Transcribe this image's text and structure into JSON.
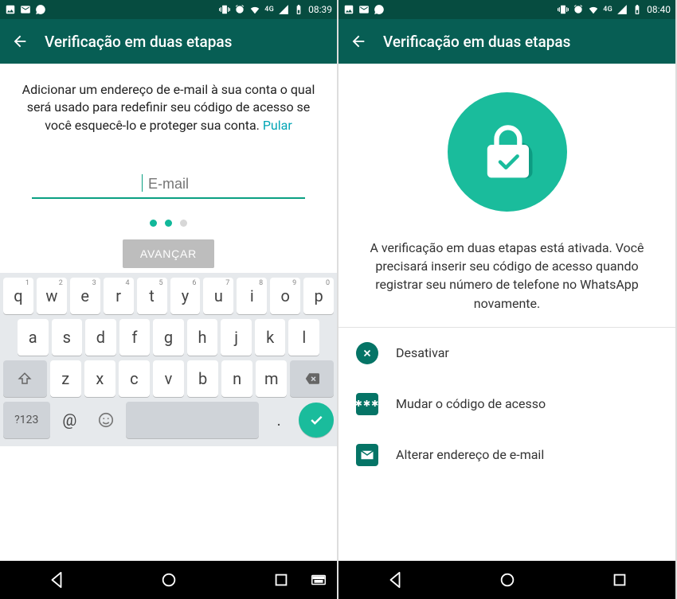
{
  "left": {
    "status": {
      "time": "08:39",
      "network": "4G"
    },
    "appbar_title": "Verificação em duas etapas",
    "description": "Adicionar um endereço de e-mail à sua conta o qual será usado para redefinir seu código de acesso se você esquecê-lo e proteger sua conta.",
    "skip_label": "Pular",
    "email_placeholder": "E-mail",
    "next_button": "AVANÇAR",
    "keyboard": {
      "row1": [
        {
          "k": "q",
          "s": "1"
        },
        {
          "k": "w",
          "s": "2"
        },
        {
          "k": "e",
          "s": "3"
        },
        {
          "k": "r",
          "s": "4"
        },
        {
          "k": "t",
          "s": "5"
        },
        {
          "k": "y",
          "s": "6"
        },
        {
          "k": "u",
          "s": "7"
        },
        {
          "k": "i",
          "s": "8"
        },
        {
          "k": "o",
          "s": "9"
        },
        {
          "k": "p",
          "s": "0"
        }
      ],
      "row2": [
        "a",
        "s",
        "d",
        "f",
        "g",
        "h",
        "j",
        "k",
        "l"
      ],
      "row3": [
        "z",
        "x",
        "c",
        "v",
        "b",
        "n",
        "m"
      ],
      "symkey": "?123",
      "at": "@",
      "period": "."
    }
  },
  "right": {
    "status": {
      "time": "08:40",
      "network": "4G"
    },
    "appbar_title": "Verificação em duas etapas",
    "description": "A verificação em duas etapas está ativada. Você precisará inserir seu código de acesso quando registrar seu número de telefone no WhatsApp novamente.",
    "options": {
      "disable": "Desativar",
      "change_pin": "Mudar o código de acesso",
      "change_email": "Alterar endereço de e-mail"
    }
  }
}
